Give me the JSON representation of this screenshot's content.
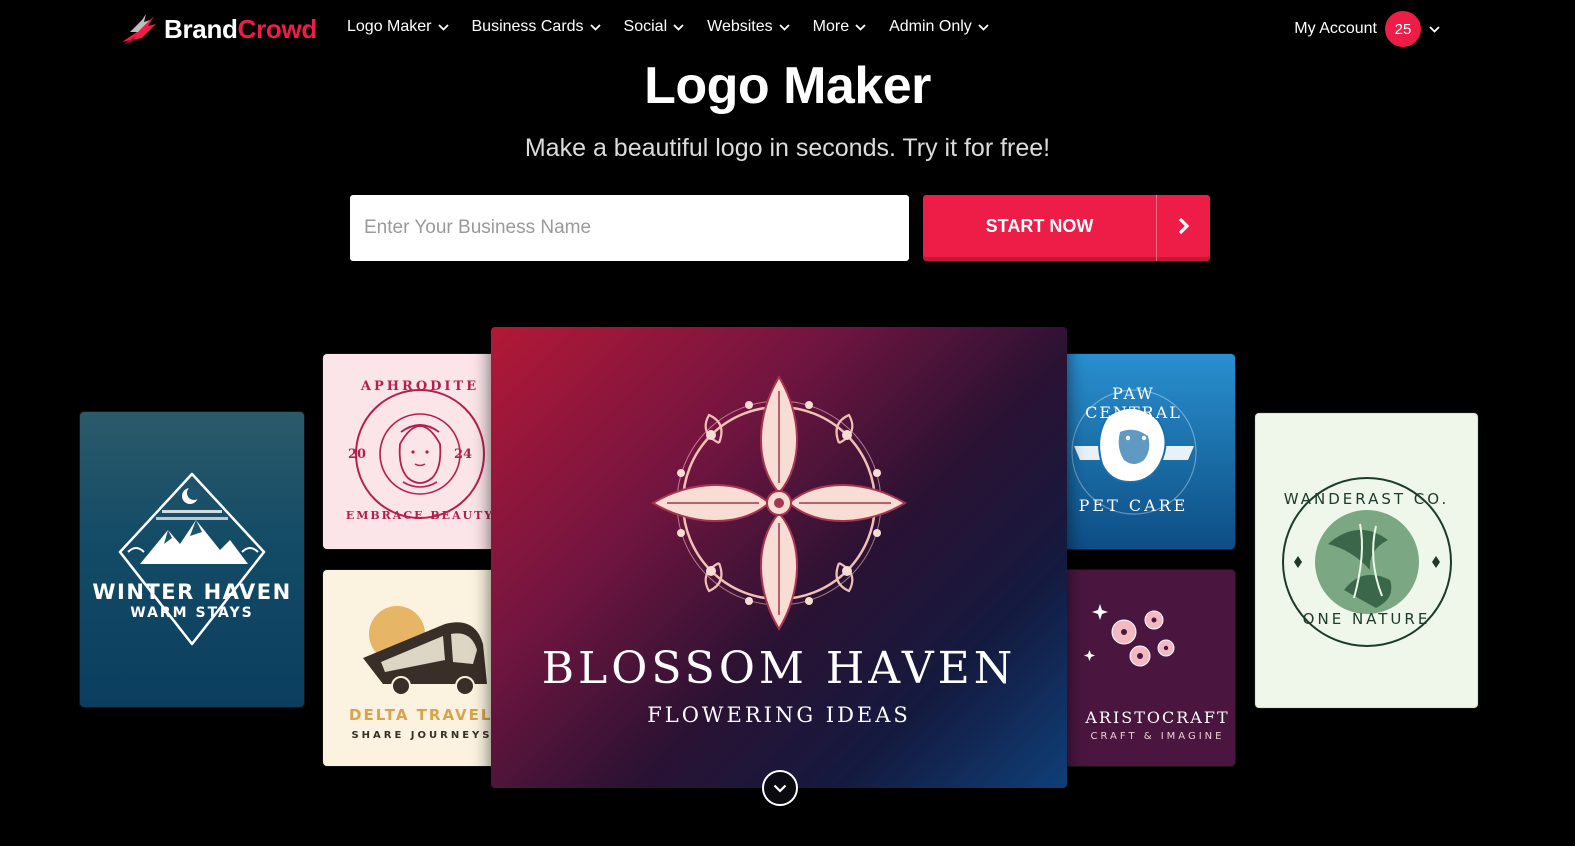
{
  "brand": {
    "part1": "Brand",
    "part2": "Crowd",
    "accent": "#ee1d47"
  },
  "nav": {
    "items": [
      {
        "label": "Logo Maker"
      },
      {
        "label": "Business Cards"
      },
      {
        "label": "Social"
      },
      {
        "label": "Websites"
      },
      {
        "label": "More"
      },
      {
        "label": "Admin Only"
      }
    ],
    "account_label": "My Account",
    "notification_count": "25"
  },
  "hero": {
    "title": "Logo Maker",
    "subtitle": "Make a beautiful logo in seconds. Try it for free!",
    "input_placeholder": "Enter Your Business Name",
    "cta_label": "START NOW"
  },
  "cards": {
    "winter": {
      "line1": "WINTER HAVEN",
      "line2": "WARM STAYS"
    },
    "aphrodite": {
      "top": "APHRODITE",
      "bottom": "EMBRACE BEAUTY",
      "left_num": "20",
      "right_num": "24"
    },
    "delta": {
      "line1": "DELTA TRAVELS",
      "line2": "SHARE JOURNEYS"
    },
    "blossom": {
      "line1": "BLOSSOM HAVEN",
      "line2": "FLOWERING IDEAS"
    },
    "paw": {
      "top": "PAW CENTRAL",
      "bottom": "PET CARE"
    },
    "aristo": {
      "line1": "ARISTOCRAFT",
      "line2": "CRAFT & IMAGINE"
    },
    "wander": {
      "top": "WANDERAST CO.",
      "bottom": "ONE NATURE"
    }
  }
}
